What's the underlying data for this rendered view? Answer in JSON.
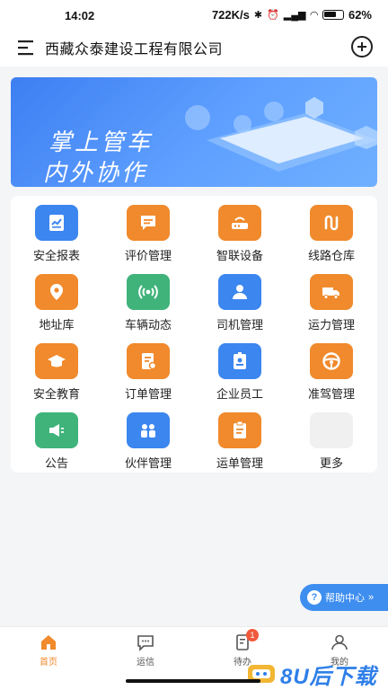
{
  "status_bar": {
    "time": "14:02",
    "network_speed": "722K/s",
    "battery": "62%"
  },
  "header": {
    "title": "西藏众泰建设工程有限公司"
  },
  "banner": {
    "line1": "掌上管车",
    "line2": "内外协作"
  },
  "grid": [
    {
      "label": "安全报表",
      "icon": "chart-report-icon",
      "color": "#3b86ef"
    },
    {
      "label": "评价管理",
      "icon": "comment-review-icon",
      "color": "#f08a2c"
    },
    {
      "label": "智联设备",
      "icon": "router-device-icon",
      "color": "#f08a2c"
    },
    {
      "label": "线路仓库",
      "icon": "route-warehouse-icon",
      "color": "#f08a2c"
    },
    {
      "label": "地址库",
      "icon": "location-pin-icon",
      "color": "#f08a2c"
    },
    {
      "label": "车辆动态",
      "icon": "signal-broadcast-icon",
      "color": "#3fb37a"
    },
    {
      "label": "司机管理",
      "icon": "driver-person-icon",
      "color": "#3b86ef"
    },
    {
      "label": "运力管理",
      "icon": "truck-icon",
      "color": "#f08a2c"
    },
    {
      "label": "安全教育",
      "icon": "graduation-cap-icon",
      "color": "#f08a2c"
    },
    {
      "label": "订单管理",
      "icon": "order-document-icon",
      "color": "#f08a2c"
    },
    {
      "label": "企业员工",
      "icon": "employee-badge-icon",
      "color": "#3b86ef"
    },
    {
      "label": "准驾管理",
      "icon": "steering-wheel-icon",
      "color": "#f08a2c"
    },
    {
      "label": "公告",
      "icon": "megaphone-icon",
      "color": "#3fb37a"
    },
    {
      "label": "伙伴管理",
      "icon": "partners-icon",
      "color": "#3b86ef"
    },
    {
      "label": "运单管理",
      "icon": "waybill-icon",
      "color": "#f08a2c"
    },
    {
      "label": "更多",
      "icon": "more-apps-icon",
      "color": "#f0f0f0"
    }
  ],
  "help": {
    "label": "帮助中心",
    "arrow": "»"
  },
  "tabs": [
    {
      "label": "首页",
      "icon": "home-icon",
      "active": true
    },
    {
      "label": "运信",
      "icon": "message-icon",
      "active": false
    },
    {
      "label": "待办",
      "icon": "todo-icon",
      "active": false,
      "badge": "1"
    },
    {
      "label": "我的",
      "icon": "profile-icon",
      "active": false
    }
  ],
  "watermark": {
    "text": "8U后下载"
  }
}
